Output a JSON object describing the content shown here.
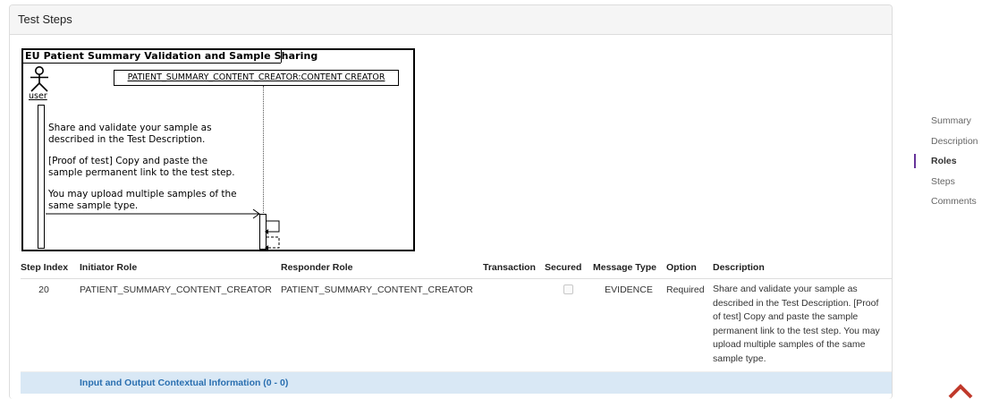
{
  "panel": {
    "title": "Test Steps"
  },
  "diagram": {
    "title": "EU Patient Summary Validation and Sample Sharing",
    "participant": "PATIENT_SUMMARY_CONTENT_CREATOR:CONTENT CREATOR",
    "actor": "user",
    "messages": [
      {
        "line1": "Share and validate your sample as",
        "line2": "described in the Test Description."
      },
      {
        "line1": "[Proof of test] Copy and paste the",
        "line2": "sample permanent link to the test step."
      },
      {
        "line1": "You may upload multiple samples of the",
        "line2": "same sample type."
      }
    ]
  },
  "table": {
    "headers": {
      "step_index": "Step Index",
      "initiator": "Initiator Role",
      "responder": "Responder Role",
      "transaction": "Transaction",
      "secured": "Secured",
      "message_type": "Message Type",
      "option": "Option",
      "description": "Description"
    },
    "rows": [
      {
        "step_index": "20",
        "initiator": "PATIENT_SUMMARY_CONTENT_CREATOR",
        "responder": "PATIENT_SUMMARY_CONTENT_CREATOR",
        "transaction": "",
        "secured": false,
        "message_type": "EVIDENCE",
        "option": "Required",
        "description": "Share and validate your sample as described in the Test Description. [Proof of test] Copy and paste the sample permanent link to the test step. You may upload multiple samples of the same sample type."
      }
    ],
    "info_row": "Input and Output Contextual Information (0 - 0)"
  },
  "side_nav": {
    "items": [
      "Summary",
      "Description",
      "Roles",
      "Steps",
      "Comments"
    ],
    "active": "Roles"
  },
  "colors": {
    "accent": "#663399",
    "info_bg": "#d9e8f5",
    "info_text": "#2a6fb0"
  }
}
